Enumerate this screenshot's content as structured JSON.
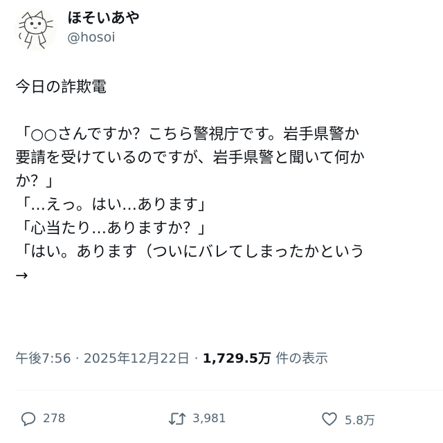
{
  "author": {
    "display_name": "ほそいあや",
    "handle": "@hosoi",
    "avatar_icon": "cat-doodle-avatar-icon"
  },
  "post": {
    "lines": [
      "今日の詐欺電",
      "「○○さんですか？こちら警視庁です。岩手県警か",
      "要請を受けているのですが、岩手県警と聞いて何か",
      "か？」",
      "「…えっ。はい…あります」",
      "「心当たり…ありますか？」",
      "「はい。あります（ついにバレてしまったかという",
      "→"
    ]
  },
  "meta": {
    "time": "午後7:56",
    "separator": "·",
    "date": "2025年12月22日",
    "views_count": "1,729.5万",
    "views_label": "件の表示"
  },
  "actions": {
    "reply_count": "278",
    "repost_count": "3,981",
    "like_count": "5.8万",
    "reply_icon": "reply-bubble-icon",
    "repost_icon": "repost-arrows-icon",
    "like_icon": "heart-icon"
  },
  "colors": {
    "text": "#0f1419",
    "secondary": "#536471",
    "divider": "#eff3f4"
  }
}
